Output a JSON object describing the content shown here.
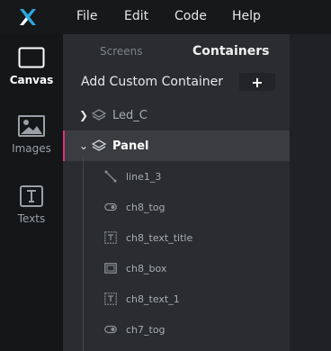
{
  "menubar": {
    "items": [
      "File",
      "Edit",
      "Code",
      "Help"
    ]
  },
  "rail": {
    "items": [
      {
        "label": "Canvas",
        "active": true
      },
      {
        "label": "Images",
        "active": false
      },
      {
        "label": "Texts",
        "active": false
      }
    ]
  },
  "panel": {
    "tabs": [
      "Screens",
      "Containers"
    ],
    "active_tab": "Containers",
    "add_label": "Add Custom Container",
    "add_button": "+",
    "containers": [
      {
        "name": "Led_C",
        "expanded": false
      },
      {
        "name": "Panel",
        "expanded": true,
        "selected": true
      }
    ],
    "children": [
      {
        "name": "line1_3",
        "icon": "line-icon"
      },
      {
        "name": "ch8_tog",
        "icon": "toggle-icon"
      },
      {
        "name": "ch8_text_title",
        "icon": "text-icon"
      },
      {
        "name": "ch8_box",
        "icon": "box-icon"
      },
      {
        "name": "ch8_text_1",
        "icon": "text-icon"
      },
      {
        "name": "ch7_tog",
        "icon": "toggle-icon"
      }
    ]
  },
  "colors": {
    "accent": "#e0307a",
    "logo": "#2aa8e0"
  }
}
